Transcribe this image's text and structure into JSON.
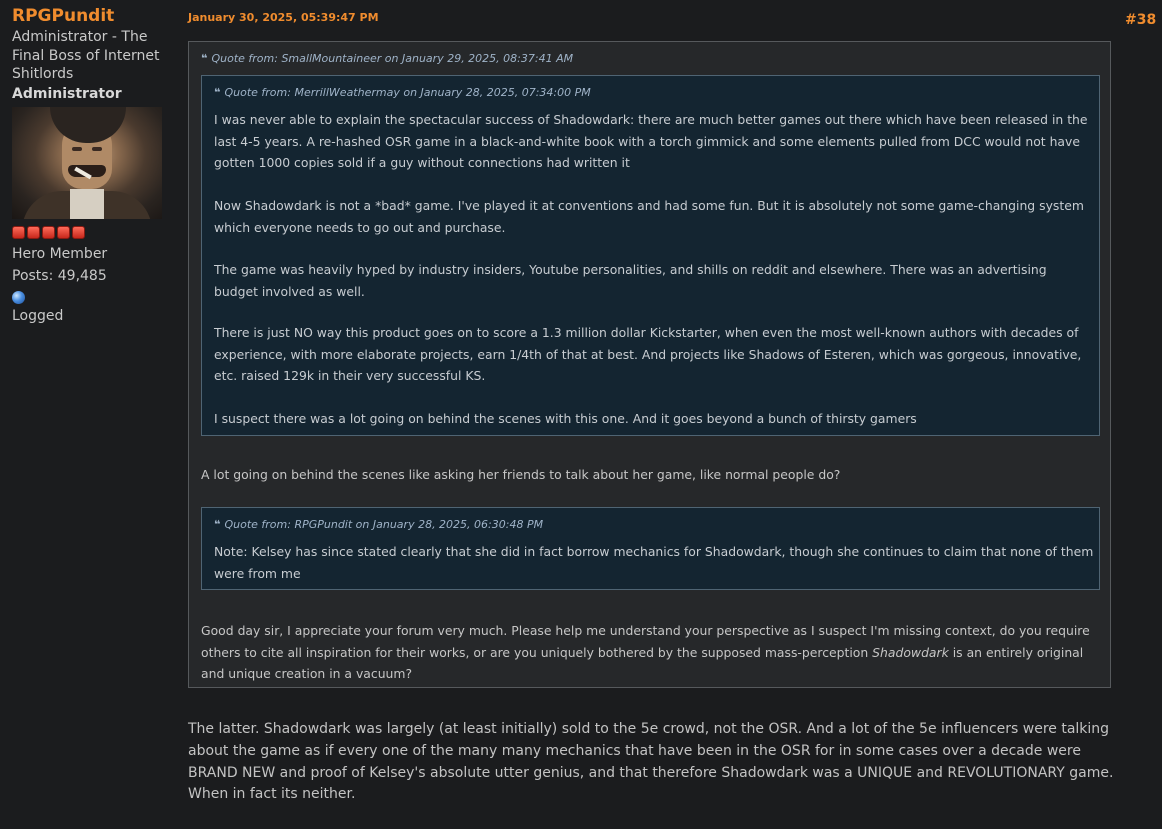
{
  "poster": {
    "name": "RPGPundit",
    "title": "Administrator - The Final Boss of Internet Shitlords",
    "group": "Administrator",
    "rank": "Hero Member",
    "posts": "Posts: 49,485",
    "logged": "Logged"
  },
  "post": {
    "date": "January 30, 2025, 05:39:47 PM",
    "number": "#38",
    "outer_quote": {
      "header": "Quote from: SmallMountaineer on January 29, 2025, 08:37:41 AM",
      "inner_quote_1": {
        "header": "Quote from: MerrillWeathermay on January 28, 2025, 07:34:00 PM",
        "p1": "I was never able to explain the spectacular success of Shadowdark: there are much better games out there which have been released in the last 4-5 years. A re-hashed OSR game in a black-and-white book with a torch gimmick and some elements pulled from DCC would not have gotten 1000 copies sold if a guy without connections had written it",
        "p2": "Now Shadowdark is not a *bad* game. I've played it at conventions and had some fun. But it is absolutely not some game-changing system which everyone needs to go out and purchase.",
        "p3": "The game was heavily hyped by industry insiders, Youtube personalities, and shills on reddit and elsewhere. There was an advertising budget involved as well.",
        "p4": "There is just NO way this product goes on to score a 1.3 million dollar Kickstarter, when even the most well-known authors with decades of experience, with more elaborate projects, earn 1/4th of that at best. And projects like Shadows of Esteren, which was gorgeous, innovative, etc. raised 129k in their very successful KS.",
        "p5": "I suspect there was a lot going on behind the scenes with this one. And it goes beyond a bunch of thirsty gamers"
      },
      "middle_text": "A lot going on behind the scenes like asking her friends to talk about her game, like normal people do?",
      "inner_quote_2": {
        "header": "Quote from: RPGPundit on January 28, 2025, 06:30:48 PM",
        "p1": "Note: Kelsey has since stated clearly that she did in fact borrow mechanics for Shadowdark, though she continues to claim that none of them were from me"
      },
      "closing_text_a": "Good day sir, I appreciate your forum very much. Please help me understand your perspective as I suspect I'm missing context, do you require others to cite all inspiration for their works, or are you uniquely bothered by the supposed mass-perception ",
      "closing_text_em": "Shadowdark",
      "closing_text_b": " is an entirely original and unique creation in a vacuum?"
    },
    "reply": "The latter. Shadowdark was largely (at least initially) sold to the 5e crowd, not the OSR. And a lot of the 5e influencers were talking about the game as if every one of the many many mechanics that have been in the OSR for in some cases over a decade were BRAND NEW and proof of Kelsey's absolute utter genius, and that therefore Shadowdark was a UNIQUE and REVOLUTIONARY game. When in fact its neither."
  },
  "icons": {
    "quote": "quote-icon",
    "rank_stars": "star-icon",
    "online_status": "globe-icon"
  },
  "colors": {
    "accent": "#f08c2e",
    "background": "#1b1c1e",
    "quote_bg": "#26282a",
    "nested_quote_bg": "#142531"
  }
}
